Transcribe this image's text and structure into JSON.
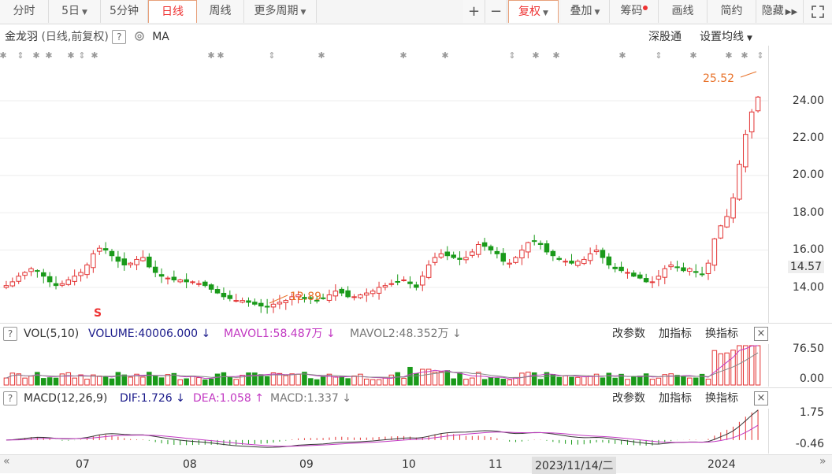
{
  "toolbar": {
    "tabs": [
      "分时",
      "5日",
      "5分钟",
      "日线",
      "周线",
      "更多周期"
    ],
    "active_tab": "日线",
    "right_buttons": [
      "+",
      "−",
      "复权",
      "叠加",
      "筹码",
      "画线",
      "简约",
      "隐藏"
    ],
    "expand_icon": "expand-icon",
    "forward_icon": "double-chevron-right-icon"
  },
  "header": {
    "stock_name": "金龙羽",
    "mode": "(日线,前复权)",
    "help": "?",
    "ma_label": "MA",
    "right_link1": "深股通",
    "right_link2": "设置均线"
  },
  "price_panel": {
    "y_ticks": [
      "24.00",
      "22.00",
      "20.00",
      "18.00",
      "16.00",
      "14.00"
    ],
    "current_price": "14.57",
    "high_annotation": "25.52",
    "low_annotation": "12.89",
    "s_marker": "S"
  },
  "vol_panel": {
    "title": "VOL(5,10)",
    "volume": "VOLUME:40006.000",
    "mavol1": "MAVOL1:58.487万",
    "mavol2": "MAVOL2:48.352万",
    "actions": [
      "改参数",
      "加指标",
      "换指标"
    ],
    "close": "×",
    "y_ticks": [
      "76.50",
      "0.00"
    ]
  },
  "macd_panel": {
    "title": "MACD(12,26,9)",
    "dif": "DIF:1.726",
    "dea": "DEA:1.058",
    "macd": "MACD:1.337",
    "actions": [
      "改参数",
      "加指标",
      "换指标"
    ],
    "close": "×",
    "y_ticks": [
      "1.75",
      "-0.46"
    ]
  },
  "x_axis": {
    "labels": [
      "07",
      "08",
      "09",
      "10",
      "11",
      "2023/11/14/二",
      "2024"
    ]
  },
  "colors": {
    "up": "#e33333",
    "down": "#1a9a1a",
    "accent": "#e8722a",
    "dea": "#c238c2",
    "mavol1": "#c238c2",
    "volume": "#1a1a8a"
  },
  "chart_data": {
    "type": "candlestick",
    "title": "金龙羽 (日线,前复权)",
    "y_range": [
      12.0,
      26.0
    ],
    "high": 25.52,
    "low": 12.89,
    "last_close": 14.57,
    "x_ticks": [
      "07",
      "08",
      "09",
      "10",
      "11",
      "2023/11/14/二",
      "2024"
    ],
    "close_series": [
      14.1,
      14.3,
      14.6,
      14.8,
      15.0,
      14.9,
      14.6,
      14.3,
      14.1,
      14.2,
      14.4,
      14.6,
      14.8,
      15.2,
      15.8,
      16.1,
      16.0,
      15.7,
      15.4,
      15.2,
      15.3,
      15.5,
      15.6,
      15.1,
      14.8,
      14.6,
      14.5,
      14.4,
      14.4,
      14.3,
      14.3,
      14.2,
      14.1,
      13.9,
      13.7,
      13.5,
      13.4,
      13.3,
      13.3,
      13.2,
      13.1,
      13.0,
      12.95,
      13.1,
      13.2,
      13.3,
      13.5,
      13.6,
      13.4,
      13.4,
      13.3,
      13.4,
      13.6,
      13.8,
      13.7,
      13.5,
      13.5,
      13.6,
      13.7,
      13.8,
      14.0,
      14.1,
      14.2,
      14.3,
      14.4,
      14.2,
      14.0,
      14.6,
      15.2,
      15.6,
      15.8,
      15.7,
      15.6,
      15.5,
      15.6,
      15.9,
      16.3,
      16.2,
      16.0,
      15.8,
      15.4,
      15.3,
      15.6,
      16.0,
      16.4,
      16.5,
      16.3,
      15.9,
      15.7,
      15.5,
      15.4,
      15.3,
      15.4,
      15.5,
      15.8,
      16.0,
      15.6,
      15.2,
      15.0,
      14.9,
      14.8,
      14.6,
      14.5,
      14.3,
      14.3,
      14.6,
      15.0,
      15.2,
      15.1,
      14.9,
      15.0,
      14.8,
      14.7,
      15.3,
      16.6,
      17.3,
      17.8,
      18.8,
      20.6,
      22.2,
      23.4,
      24.2
    ],
    "volume_max": 76.5,
    "volume_unit": "万",
    "macd_range": [
      -0.46,
      1.75
    ]
  }
}
